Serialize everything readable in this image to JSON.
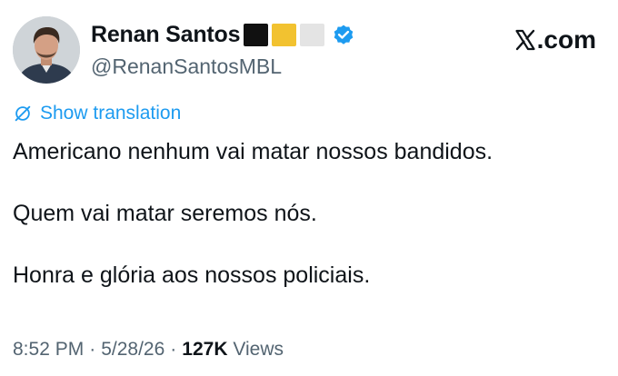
{
  "author": {
    "name": "Renan Santos",
    "handle": "@RenanSantosMBL",
    "flag_colors": [
      "#111111",
      "#f2c230",
      "#e4e4e4"
    ],
    "verified_color": "#1d9bf0"
  },
  "brand": {
    "label": ".com",
    "icon": "x-logo-icon"
  },
  "translation": {
    "label": "Show translation",
    "icon": "translate-icon",
    "color": "#1d9bf0"
  },
  "tweet": {
    "lines": [
      "Americano nenhum vai matar nossos bandidos.",
      "Quem vai matar seremos nós.",
      "Honra e glória aos nossos policiais."
    ]
  },
  "meta": {
    "time": "8:52 PM",
    "sep1": "·",
    "date": "5/28/26",
    "sep2": "·",
    "views_count": "127K",
    "views_label": "Views"
  }
}
